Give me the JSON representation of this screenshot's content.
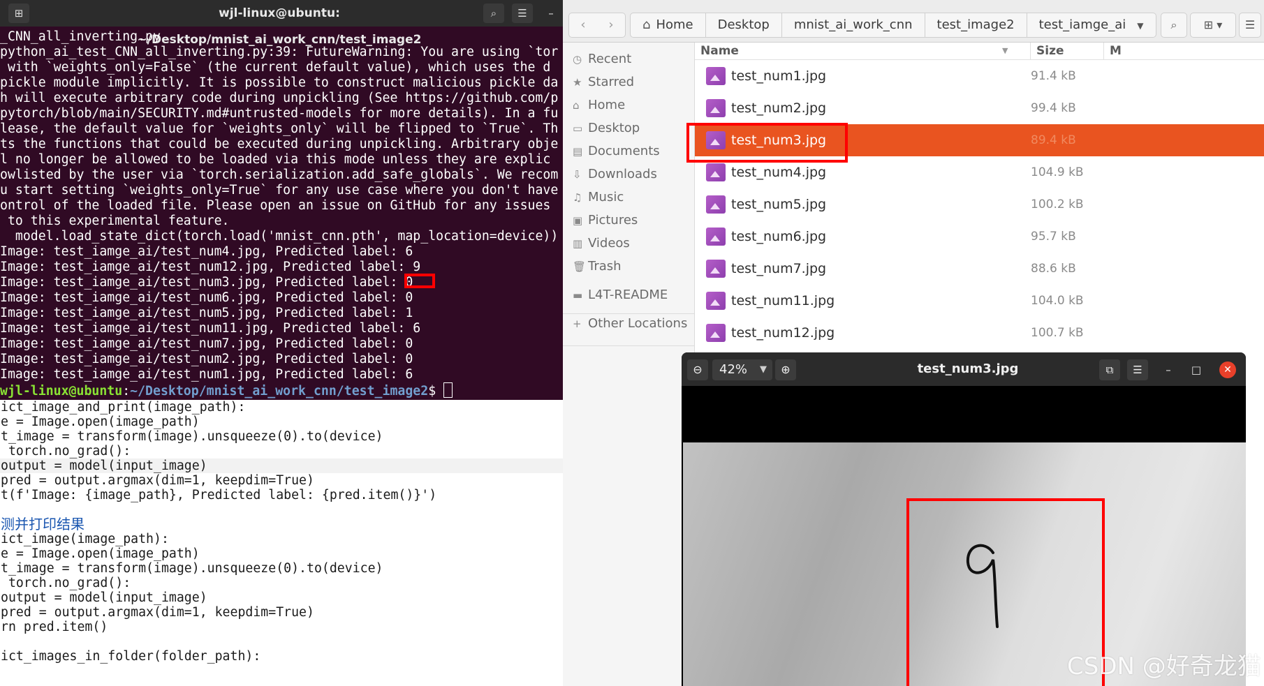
{
  "terminal": {
    "title": "wjl-linux@ubuntu: ~/Desktop/mnist_ai_work_cnn/test_image2",
    "lines": [
      "_CNN_all_inverting.py",
      "python_ai_test_CNN_all_inverting.py:39: FutureWarning: You are using `tor",
      " with `weights_only=False` (the current default value), which uses the d",
      "pickle module implicitly. It is possible to construct malicious pickle da",
      "h will execute arbitrary code during unpickling (See https://github.com/p",
      "pytorch/blob/main/SECURITY.md#untrusted-models for more details). In a fu",
      "lease, the default value for `weights_only` will be flipped to `True`. Th",
      "ts the functions that could be executed during unpickling. Arbitrary obje",
      "l no longer be allowed to be loaded via this mode unless they are explic",
      "owlisted by the user via `torch.serialization.add_safe_globals`. We recom",
      "u start setting `weights_only=True` for any use case where you don't have",
      "ontrol of the loaded file. Please open an issue on GitHub for any issues",
      " to this experimental feature.",
      "  model.load_state_dict(torch.load('mnist_cnn.pth', map_location=device))",
      "Image: test_iamge_ai/test_num4.jpg, Predicted label: 6",
      "Image: test_iamge_ai/test_num12.jpg, Predicted label: 9",
      "Image: test_iamge_ai/test_num3.jpg, Predicted label: 0",
      "Image: test_iamge_ai/test_num6.jpg, Predicted label: 0",
      "Image: test_iamge_ai/test_num5.jpg, Predicted label: 1",
      "Image: test_iamge_ai/test_num11.jpg, Predicted label: 6",
      "Image: test_iamge_ai/test_num7.jpg, Predicted label: 0",
      "Image: test_iamge_ai/test_num2.jpg, Predicted label: 0",
      "Image: test_iamge_ai/test_num1.jpg, Predicted label: 6"
    ],
    "prompt_user": "wjl-linux@ubuntu",
    "prompt_sep": ":",
    "prompt_path": "~/Desktop/mnist_ai_work_cnn/test_image2",
    "prompt_end": "$ "
  },
  "editor": {
    "lines": [
      "ict_image_and_print(image_path):",
      "e = Image.open(image_path)",
      "t_image = transform(image).unsqueeze(0).to(device)",
      " torch.no_grad():",
      "output = model(input_image)",
      "pred = output.argmax(dim=1, keepdim=True)",
      "t(f'Image: {image_path}, Predicted label: {pred.item()}')",
      "",
      "测并打印结果",
      "ict_image(image_path):",
      "e = Image.open(image_path)",
      "t_image = transform(image).unsqueeze(0).to(device)",
      " torch.no_grad():",
      "output = model(input_image)",
      "pred = output.argmax(dim=1, keepdim=True)",
      "rn pred.item()",
      "",
      "ict_images_in_folder(folder_path):"
    ]
  },
  "filemanager": {
    "breadcrumbs": [
      "Home",
      "Desktop",
      "mnist_ai_work_cnn",
      "test_image2",
      "test_iamge_ai"
    ],
    "sidebar": [
      "Recent",
      "Starred",
      "Home",
      "Desktop",
      "Documents",
      "Downloads",
      "Music",
      "Pictures",
      "Videos",
      "Trash",
      "L4T-README",
      "Other Locations"
    ],
    "columns": {
      "name": "Name",
      "size": "Size",
      "modified": "M"
    },
    "files": [
      {
        "name": "test_num1.jpg",
        "size": "91.4 kB"
      },
      {
        "name": "test_num2.jpg",
        "size": "99.4 kB"
      },
      {
        "name": "test_num3.jpg",
        "size": "89.4 kB"
      },
      {
        "name": "test_num4.jpg",
        "size": "104.9 kB"
      },
      {
        "name": "test_num5.jpg",
        "size": "100.2 kB"
      },
      {
        "name": "test_num6.jpg",
        "size": "95.7 kB"
      },
      {
        "name": "test_num7.jpg",
        "size": "88.6 kB"
      },
      {
        "name": "test_num11.jpg",
        "size": "104.0 kB"
      },
      {
        "name": "test_num12.jpg",
        "size": "100.7 kB"
      }
    ],
    "selected_index": 2
  },
  "viewer": {
    "title": "test_num3.jpg",
    "zoom": "42%"
  },
  "watermark": "CSDN @好奇龙猫",
  "colors": {
    "terminal_bg": "#300a24",
    "selection": "#e95420",
    "highlight_box": "#ff0000"
  }
}
